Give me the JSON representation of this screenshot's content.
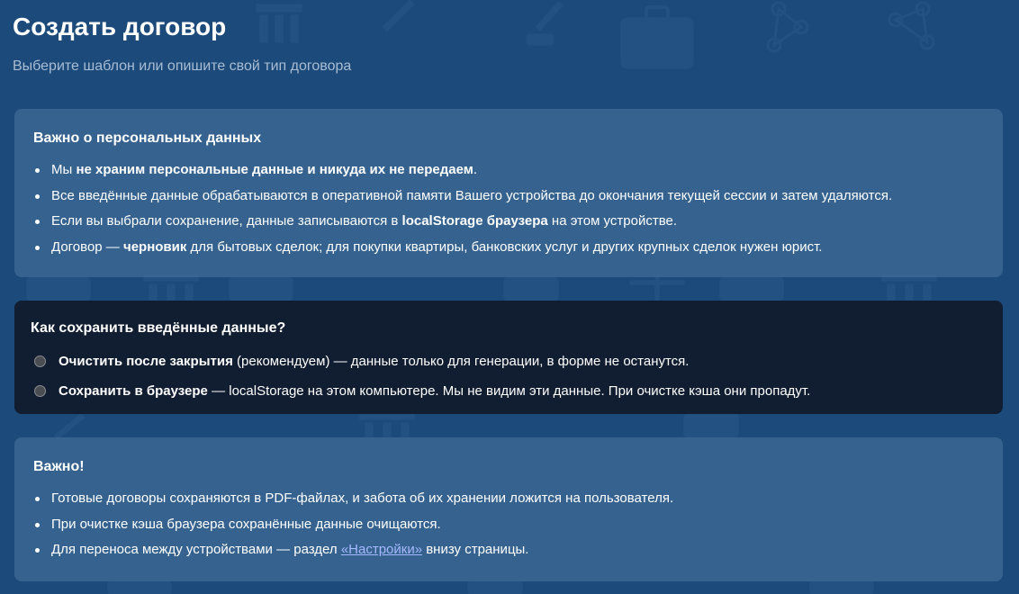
{
  "header": {
    "title": "Создать договор",
    "subtitle": "Выберите шаблон или опишите свой тип договора"
  },
  "privacy": {
    "title": "Важно о персональных данных",
    "items": [
      {
        "prefix": "Мы ",
        "bold": "не храним персональные данные и никуда их не передаем",
        "suffix": "."
      },
      {
        "text": "Все введённые данные обрабатываются в оперативной памяти Вашего устройства до окончания текущей сессии и затем удаляются."
      },
      {
        "prefix": "Если вы выбрали сохранение, данные записываются в ",
        "bold": "localStorage браузера",
        "suffix": " на этом устройстве."
      },
      {
        "prefix": "Договор — ",
        "bold": "черновик",
        "suffix": " для бытовых сделок; для покупки квартиры, банковских услуг и других крупных сделок нужен юрист."
      }
    ]
  },
  "storage": {
    "title": "Как сохранить введённые данные?",
    "options": [
      {
        "bold": "Очистить после закрытия",
        "text": " (рекомендуем) — данные только для генерации, в форме не останутся."
      },
      {
        "bold": "Сохранить в браузере",
        "text": " — localStorage на этом компьютере. Мы не видим эти данные. При очистке кэша они пропадут."
      }
    ]
  },
  "important": {
    "title": "Важно!",
    "items": [
      {
        "text": "Готовые договоры сохраняются в PDF-файлах, и забота об их хранении ложится на пользователя."
      },
      {
        "text": "При очистке кэша браузера сохранённые данные очищаются."
      },
      {
        "prefix": "Для переноса между устройствами — раздел ",
        "link": "«Настройки»",
        "suffix": " внизу страницы."
      }
    ]
  },
  "colors": {
    "background": "#1c4a7a",
    "card_light": "#3f6b95",
    "card_dark": "#111d30",
    "subtitle": "#a9bdd4",
    "link": "#a7b9ff"
  },
  "icons": [
    "law-column-icon",
    "quill-pen-icon",
    "briefcase-icon",
    "scales-icon",
    "network-icon",
    "book-icon"
  ]
}
